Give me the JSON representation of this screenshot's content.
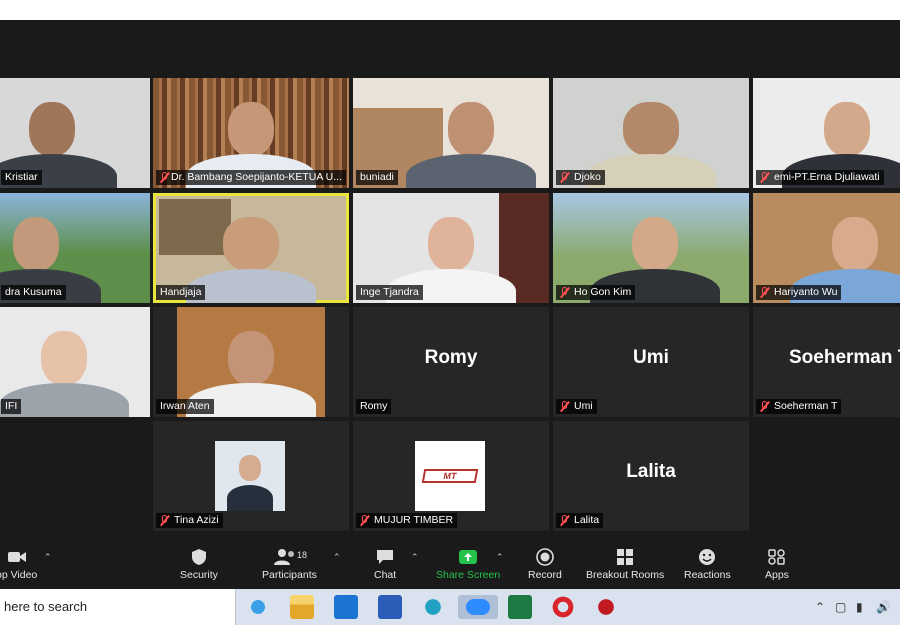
{
  "participants": [
    {
      "id": "p1",
      "name": "Kristiar",
      "muted": false,
      "video": true
    },
    {
      "id": "p2",
      "name": "Dr. Bambang Soepijanto-KETUA U...",
      "muted": true,
      "video": true
    },
    {
      "id": "p3",
      "name": "buniadi",
      "muted": false,
      "video": true
    },
    {
      "id": "p4",
      "name": "Djoko",
      "muted": true,
      "video": true
    },
    {
      "id": "p5",
      "name": "emi-PT.Erna Djuliawati",
      "muted": true,
      "video": true
    },
    {
      "id": "p6",
      "name": "dra Kusuma",
      "muted": false,
      "video": true
    },
    {
      "id": "p7",
      "name": "Handjaja",
      "muted": false,
      "video": true,
      "active": true
    },
    {
      "id": "p8",
      "name": "Inge Tjandra",
      "muted": false,
      "video": true
    },
    {
      "id": "p9",
      "name": "Ho Gon Kim",
      "muted": true,
      "video": true
    },
    {
      "id": "p10",
      "name": "Hariyanto Wu",
      "muted": true,
      "video": true
    },
    {
      "id": "p11",
      "name": "IFI",
      "muted": false,
      "video": true
    },
    {
      "id": "p12",
      "name": "Irwan Aten",
      "muted": false,
      "video": true
    },
    {
      "id": "p13",
      "name": "Romy",
      "muted": false,
      "video": false,
      "display": "Romy"
    },
    {
      "id": "p14",
      "name": "Umi",
      "muted": true,
      "video": false,
      "display": "Umi"
    },
    {
      "id": "p15",
      "name": "Soeherman T",
      "muted": true,
      "video": false,
      "display": "Soeherman T"
    },
    {
      "id": "p16",
      "name": "Tina Azizi",
      "muted": true,
      "video": false,
      "thumb": true
    },
    {
      "id": "p17",
      "name": "MUJUR TIMBER",
      "muted": true,
      "video": false,
      "thumb": true,
      "logo_text": "MT"
    },
    {
      "id": "p18",
      "name": "Lalita",
      "muted": true,
      "video": false,
      "display": "Lalita"
    }
  ],
  "toolbar": {
    "video_label": "op Video",
    "security_label": "Security",
    "participants_label": "Participants",
    "participants_count": "18",
    "chat_label": "Chat",
    "share_label": "Share Screen",
    "record_label": "Record",
    "breakout_label": "Breakout Rooms",
    "reactions_label": "Reactions",
    "apps_label": "Apps"
  },
  "taskbar": {
    "search_text": "here to search",
    "apps": [
      "edge-icon",
      "file-explorer-icon",
      "mail-icon",
      "word-icon",
      "edge-browser-icon",
      "zoom-icon",
      "excel-icon",
      "opera-icon",
      "game-icon"
    ]
  },
  "colors": {
    "active_speaker": "#e8e63c",
    "muted": "#ff5252",
    "share_green": "#24c24b",
    "background": "#1a1a1a"
  }
}
